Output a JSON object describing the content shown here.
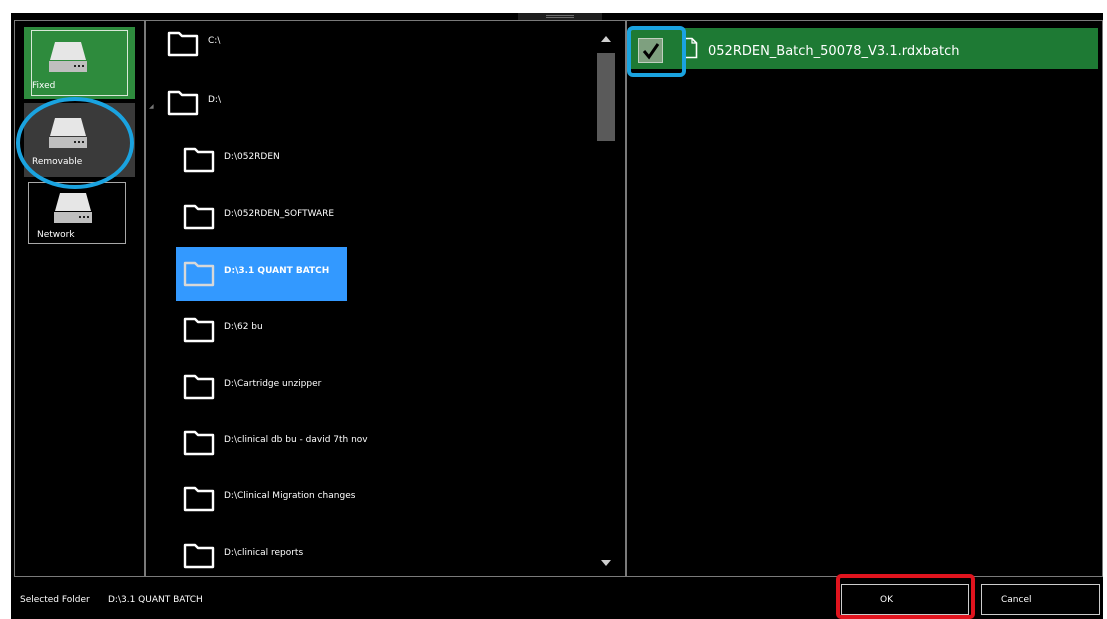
{
  "drives": [
    {
      "id": "fixed",
      "label": "Fixed",
      "selected": true
    },
    {
      "id": "removable",
      "label": "Removable",
      "selected": false
    },
    {
      "id": "network",
      "label": "Network",
      "selected": false
    }
  ],
  "folders": [
    {
      "label": "C:\\",
      "level": 0,
      "selected": false
    },
    {
      "label": "D:\\",
      "level": 0,
      "selected": false
    },
    {
      "label": "D:\\052RDEN",
      "level": 1,
      "selected": false
    },
    {
      "label": "D:\\052RDEN_SOFTWARE",
      "level": 1,
      "selected": false
    },
    {
      "label": "D:\\3.1 QUANT BATCH",
      "level": 1,
      "selected": true
    },
    {
      "label": "D:\\62 bu",
      "level": 1,
      "selected": false
    },
    {
      "label": "D:\\Cartridge unzipper",
      "level": 1,
      "selected": false
    },
    {
      "label": "D:\\clinical db bu - david 7th nov",
      "level": 1,
      "selected": false
    },
    {
      "label": "D:\\Clinical Migration changes",
      "level": 1,
      "selected": false
    },
    {
      "label": "D:\\clinical reports",
      "level": 1,
      "selected": false
    }
  ],
  "files": [
    {
      "label": "052RDEN_Batch_50078_V3.1.rdxbatch",
      "checked": true
    }
  ],
  "status": {
    "selected_folder_label": "Selected Folder",
    "selected_folder_value": "D:\\3.1 QUANT BATCH"
  },
  "buttons": {
    "ok": "OK",
    "cancel": "Cancel"
  },
  "icons": {
    "drive": "hard-drive-icon",
    "folder": "folder-icon",
    "file": "document-icon",
    "check": "checkmark-icon"
  },
  "colors": {
    "background": "#000000",
    "drive_selected": "#2e8b3d",
    "folder_selected": "#3399ff",
    "file_row": "#1e7a34",
    "annotation_circle": "#1aa3e0",
    "annotation_rect": "#e0141e"
  }
}
